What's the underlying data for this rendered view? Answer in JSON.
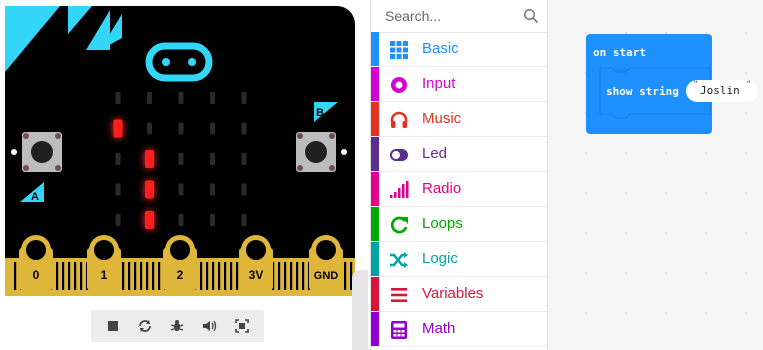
{
  "simulator": {
    "pins": [
      "0",
      "1",
      "2",
      "3V",
      "GND"
    ],
    "button_a": "A",
    "button_b": "B",
    "led_matrix": [
      [
        0,
        0,
        0,
        0,
        0
      ],
      [
        1,
        0,
        0,
        0,
        0
      ],
      [
        0,
        1,
        0,
        0,
        0
      ],
      [
        0,
        1,
        0,
        0,
        0
      ],
      [
        0,
        1,
        0,
        0,
        0
      ]
    ],
    "controls": [
      "stop-icon",
      "restart-icon",
      "debug-icon",
      "mute-icon",
      "fullscreen-icon"
    ]
  },
  "toolbox": {
    "search_placeholder": "Search...",
    "categories": [
      {
        "label": "Basic",
        "color": "#1E90FF",
        "icon": "grid-icon"
      },
      {
        "label": "Input",
        "color": "#D400D4",
        "icon": "input-circle-icon"
      },
      {
        "label": "Music",
        "color": "#E63022",
        "icon": "headphones-icon"
      },
      {
        "label": "Led",
        "color": "#5C2D91",
        "icon": "toggle-icon"
      },
      {
        "label": "Radio",
        "color": "#E3008C",
        "icon": "signal-bars-icon"
      },
      {
        "label": "Loops",
        "color": "#00AA00",
        "icon": "loop-arrow-icon"
      },
      {
        "label": "Logic",
        "color": "#00A4A6",
        "icon": "shuffle-icon"
      },
      {
        "label": "Variables",
        "color": "#DC143C",
        "icon": "list-lines-icon"
      },
      {
        "label": "Math",
        "color": "#9400D3",
        "icon": "calculator-icon"
      }
    ]
  },
  "workspace": {
    "block_on_start": "on start",
    "block_show_string": "show string",
    "string_value": "Joslin",
    "block_color": "#1E90FF"
  }
}
